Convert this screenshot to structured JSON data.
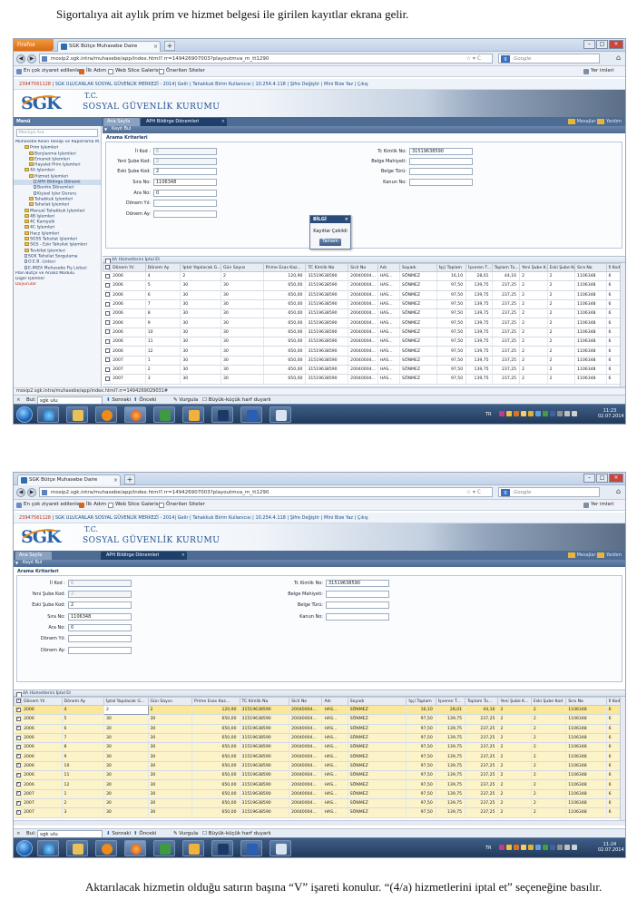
{
  "captions": {
    "top": "Sigortalıya ait aylık prim ve hizmet belgesi ile girilen kayıtlar ekrana gelir.",
    "bottom": "Aktarılacak hizmetin olduğu satırın başına “V” işareti konulur. “(4/a) hizmetlerini iptal et” seçeneğine basılır."
  },
  "browser": {
    "firefox_label": "Firefox",
    "tab_title": "SGK Bütçe Muhasebe Daire Başkanlığı",
    "url": "mosip2.sgk.intra/muhasebe/app/index.html?.rr=149426907003?playoutmva_m_tt1290",
    "search_placeholder": "Google",
    "bookmarks": [
      "En çok ziyaret edilenler",
      "İlk Adım",
      "Web Slice Galerisi",
      "Önerilen Siteler"
    ],
    "bookmarks_right": "Yer imleri"
  },
  "sgk": {
    "topline_id": "23947561128",
    "topline_text": "SGK ULUCANLAR SOSYAL GÜVENLİK MERKEZİ - 2014| Gelir | Tahakkuk Birim Kullanıcısı | 10.254.4.118 | Şifre Değiştir | Mini Bize Yaz | Çıkış",
    "logo": "SGK",
    "tc": "T.C.",
    "name": "SOSYAL GÜVENLİK KURUMU"
  },
  "menubar": {
    "side_head": "Menü",
    "tab_home": "Ana Sayfa",
    "tab_aph": "APH Bildirge Dönemleri",
    "right1": "Mesajlar",
    "right2": "Yardım"
  },
  "sidebar": {
    "search_placeholder": "Menüyü Ara",
    "items": [
      "Muhasebe Kesin Hesap ve Raporlama M.",
      "Prim İşlemleri",
      "Borçlanma İşlemleri",
      "Emanet İşlemleri",
      "Hayalet Prim İşlemleri",
      "4A İşlemleri",
      "Hizmet İşlemleri",
      "APH Bildirge Dönemi",
      "Bordro Dönemleri",
      "Kişisel İşler Dururu",
      "Tahakkuk İşlemleri",
      "Tahsilat İşlemleri",
      "Manuel Tahakkuk İşlemleri",
      "4B İşlemleri",
      "4C Kamyolk",
      "4C İşlemleri",
      "Hacz İşlemleri",
      "SGSS Tahsilat İşlemleri",
      "SGS - Eski Tahsilat İşlemleri",
      "Tevkifat İşlemleri",
      "SGK Tahsilat Sorgulama",
      "Ö.E.B. Listesi",
      "E-İMZA Muhasebe Fiş Listesi",
      "Plan Bütçe ve Analiz Modülü",
      "Diğer İşlemler",
      "Duyurular"
    ]
  },
  "panels": {
    "kayit_bul": "Kayıt Bul",
    "arama_kriterleri": "Arama Kriterleri",
    "grid_title": "4A Hizmetlerini İptal Et"
  },
  "form": {
    "il_kod_label": "İl Kod :",
    "il_kod": "6",
    "yeni_sube_label": "Yeni Şube Kod:",
    "yeni_sube": "2",
    "eski_sube_label": "Eski Şube Kod:",
    "eski_sube": "2",
    "sira_no_label": "Sıra No:",
    "sira_no": "1106348",
    "ara_no_label": "Ara No:",
    "ara_no": "0",
    "donem_yil_label": "Dönem Yıl:",
    "donem_yil": "",
    "donem_ay_label": "Dönem Ay:",
    "donem_ay": "",
    "tc_label": "Tc Kimlik No:",
    "tc": "31519638590",
    "belge_mahiyeti_label": "Belge Mahiyeti:",
    "belge_turu_label": "Belge Türü:",
    "kanun_label": "Kanun No:"
  },
  "dialog": {
    "title": "BİLGİ",
    "message": "Kayıtlar Çekildi",
    "button": "Tamam"
  },
  "grid": {
    "columns": [
      "Dönem Yıl",
      "Dönem Ay",
      "İptal Yapılacak G...",
      "Gün Sayısı",
      "Prime Esas Kaz...",
      "TC Kimlik No",
      "Sicil No",
      "Adı",
      "Soyadı",
      "İşçi Toplam",
      "İşveren T...",
      "Toplam Tu...",
      "Yeni Şube K...",
      "Eski Şube Kod",
      "Sıra No",
      "İl Kod"
    ],
    "rows": [
      [
        "2006",
        "4",
        "2",
        "2",
        "120,90",
        "31519638590",
        "20040004...",
        "HAS...",
        "SÖNMEZ",
        "16,10",
        "28,01",
        "44,16",
        "2",
        "2",
        "1106348",
        "6"
      ],
      [
        "2006",
        "5",
        "30",
        "30",
        "650,00",
        "31519638590",
        "20040004...",
        "HAS...",
        "SÖNMEZ",
        "97,50",
        "139,75",
        "237,25",
        "2",
        "2",
        "1106348",
        "6"
      ],
      [
        "2006",
        "6",
        "30",
        "30",
        "650,00",
        "31519638590",
        "20040004...",
        "HAS...",
        "SÖNMEZ",
        "97,50",
        "139,75",
        "237,25",
        "2",
        "2",
        "1106348",
        "6"
      ],
      [
        "2006",
        "7",
        "30",
        "30",
        "650,00",
        "31519638590",
        "20040004...",
        "HAS...",
        "SÖNMEZ",
        "97,50",
        "139,75",
        "237,25",
        "2",
        "2",
        "1106348",
        "6"
      ],
      [
        "2006",
        "8",
        "30",
        "30",
        "650,00",
        "31519638590",
        "20040004...",
        "HAS...",
        "SÖNMEZ",
        "97,50",
        "139,75",
        "237,25",
        "2",
        "2",
        "1106348",
        "6"
      ],
      [
        "2006",
        "9",
        "30",
        "30",
        "650,00",
        "31519638590",
        "20040004...",
        "HAS...",
        "SÖNMEZ",
        "97,50",
        "139,75",
        "237,25",
        "2",
        "2",
        "1106348",
        "6"
      ],
      [
        "2006",
        "10",
        "30",
        "30",
        "650,00",
        "31519638590",
        "20040004...",
        "HAS...",
        "SÖNMEZ",
        "97,50",
        "139,75",
        "237,25",
        "2",
        "2",
        "1106348",
        "6"
      ],
      [
        "2006",
        "11",
        "30",
        "30",
        "650,00",
        "31519638590",
        "20040004...",
        "HAS...",
        "SÖNMEZ",
        "97,50",
        "139,75",
        "237,25",
        "2",
        "2",
        "1106348",
        "6"
      ],
      [
        "2006",
        "12",
        "30",
        "30",
        "650,00",
        "31519638590",
        "20040004...",
        "HAS...",
        "SÖNMEZ",
        "97,50",
        "139,75",
        "237,25",
        "2",
        "2",
        "1106348",
        "6"
      ],
      [
        "2007",
        "1",
        "30",
        "30",
        "650,00",
        "31519638590",
        "20040004...",
        "HAS...",
        "SÖNMEZ",
        "97,50",
        "139,75",
        "237,25",
        "2",
        "2",
        "1106348",
        "6"
      ],
      [
        "2007",
        "2",
        "30",
        "30",
        "650,00",
        "31519638590",
        "20040004...",
        "HAS...",
        "SÖNMEZ",
        "97,50",
        "139,75",
        "237,25",
        "2",
        "2",
        "1106348",
        "6"
      ],
      [
        "2007",
        "3",
        "30",
        "30",
        "650,00",
        "31519638590",
        "20040004...",
        "HAS...",
        "SÖNMEZ",
        "97,50",
        "139,75",
        "237,25",
        "2",
        "2",
        "1106348",
        "6"
      ]
    ]
  },
  "status_url": "mosip2.sgk.intra/muhasebe/app/index.html?.rr=1494269029031#",
  "findbar": {
    "label": "Bul:",
    "value": "sgk ulu",
    "next": "Sonraki",
    "prev": "Önceki",
    "highlight": "Vurgula",
    "matchcase": "Büyük-küçük harf duyarlı"
  },
  "taskbar": {
    "lang": "TR",
    "shot1_time": "11:23",
    "shot1_date": "02.07.2014",
    "shot2_time": "11:24",
    "shot2_date": "02.07.2014"
  },
  "colors": {
    "sgk_blue": "#2a63a8",
    "selected_row": "#fcf3c8",
    "dialog_header": "#2b4b77"
  }
}
